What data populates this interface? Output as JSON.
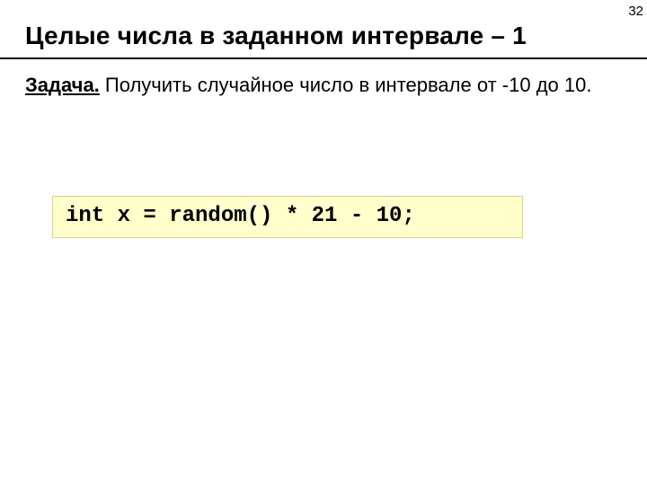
{
  "page_number": "32",
  "title": "Целые числа в заданном интервале – 1",
  "task": {
    "label": "Задача.",
    "text": " Получить случайное число в интервале от -10 до 10."
  },
  "code": "int x = random() * 21 - 10;"
}
